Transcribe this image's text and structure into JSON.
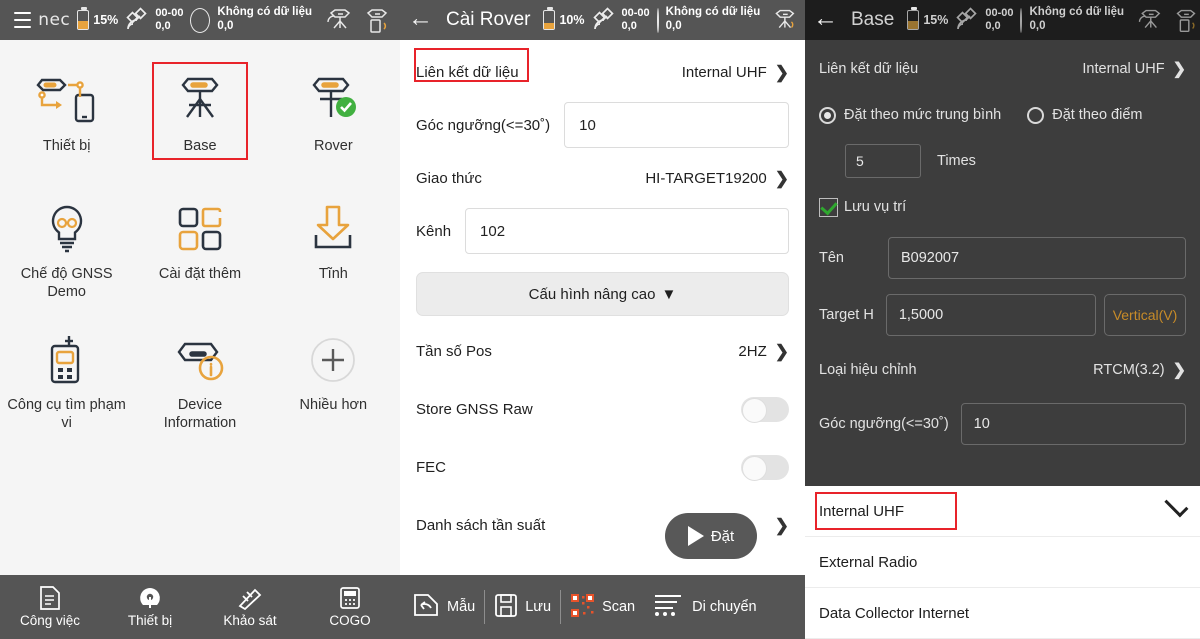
{
  "left": {
    "statusbar": {
      "brand": "nec",
      "battery": "15%",
      "sat_line1": "00-00",
      "sat_line2": "0,0",
      "nodata_line1": "Không có dữ liệu",
      "nodata_line2": "0,0",
      "icons": [
        "hamburger-icon",
        "battery-icon",
        "satellite-icon",
        "circle-icon",
        "base-station-icon",
        "rover-device-icon"
      ]
    },
    "grid": [
      {
        "label": "Thiết bị",
        "icon": "device-link-icon",
        "highlight": false
      },
      {
        "label": "Base",
        "icon": "base-tripod-icon",
        "highlight": true
      },
      {
        "label": "Rover",
        "icon": "rover-check-icon",
        "highlight": false
      },
      {
        "label": "Chế độ GNSS Demo",
        "icon": "lightbulb-icon",
        "highlight": false
      },
      {
        "label": "Cài đặt thêm",
        "icon": "four-squares-icon",
        "highlight": false
      },
      {
        "label": "Tĩnh",
        "icon": "download-icon",
        "highlight": false
      },
      {
        "label": "Công cụ tìm phạm vi",
        "icon": "radio-handheld-icon",
        "highlight": false
      },
      {
        "label": "Device Information",
        "icon": "device-info-icon",
        "highlight": false
      },
      {
        "label": "Nhiều hơn",
        "icon": "plus-circle-icon",
        "highlight": false
      }
    ],
    "bottomnav": [
      {
        "label": "Công việc",
        "icon": "document-icon"
      },
      {
        "label": "Thiết bị",
        "icon": "signal-icon"
      },
      {
        "label": "Khảo sát",
        "icon": "survey-icon"
      },
      {
        "label": "COGO",
        "icon": "calculator-icon"
      }
    ]
  },
  "mid": {
    "statusbar": {
      "back": "←",
      "title": "Cài Rover",
      "battery": "10%",
      "sat_line1": "00-00",
      "sat_line2": "0,0",
      "nodata_line1": "Không có dữ liệu",
      "nodata_line2": "0,0"
    },
    "rows": {
      "datalink_label": "Liên kết dữ liệu",
      "datalink_value": "Internal UHF",
      "angle_label": "Góc ngưỡng(<=30˚)",
      "angle_value": "10",
      "protocol_label": "Giao thức",
      "protocol_value": "HI-TARGET19200",
      "channel_label": "Kênh",
      "channel_value": "102",
      "advanced_label": "Cấu hình nâng cao",
      "advanced_caret": "▼",
      "posfreq_label": "Tần số Pos",
      "posfreq_value": "2HZ",
      "storegnss_label": "Store GNSS Raw",
      "fec_label": "FEC",
      "freqlist_label": "Danh sách tần suất"
    },
    "fab_label": "Đặt",
    "bottombar": [
      {
        "label": "Mẫu",
        "icon": "undo-template-icon"
      },
      {
        "label": "Lưu",
        "icon": "save-icon"
      },
      {
        "label": "Scan",
        "icon": "qr-scan-icon"
      },
      {
        "label": "Di chuyển",
        "icon": "move-list-icon"
      }
    ]
  },
  "right": {
    "statusbar": {
      "back": "←",
      "title": "Base",
      "battery": "15%",
      "sat_line1": "00-00",
      "sat_line2": "0,0",
      "nodata_line1": "Không có dữ liệu",
      "nodata_line2": "0,0"
    },
    "rows": {
      "datalink_label": "Liên kết dữ liệu",
      "datalink_value": "Internal UHF",
      "radio_avg_label": "Đặt theo mức trung bình",
      "radio_point_label": "Đặt theo điểm",
      "times_value": "5",
      "times_label": "Times",
      "save_pos_label": "Lưu vụ trí",
      "name_label": "Tên",
      "name_value": "B092007",
      "targeth_label": "Target H",
      "targeth_value": "1,5000",
      "vertical_label": "Vertical(V)",
      "corr_label": "Loại hiệu chỉnh",
      "corr_value": "RTCM(3.2)",
      "angle_label": "Góc ngưỡng(<=30˚)",
      "angle_value": "10"
    },
    "sheet": [
      {
        "label": "Internal UHF",
        "selected": true,
        "highlight": true
      },
      {
        "label": "External Radio",
        "selected": false,
        "highlight": false
      },
      {
        "label": "Data Collector Internet",
        "selected": false,
        "highlight": false
      }
    ]
  },
  "colors": {
    "statusbar_bg": "#555555",
    "statusbar_dark_bg": "#1d1d1d",
    "accent_orange": "#e8a33d",
    "highlight_red": "#e8232a",
    "check_green": "#2fa82f",
    "panel_bg": "#f5f5f5"
  }
}
